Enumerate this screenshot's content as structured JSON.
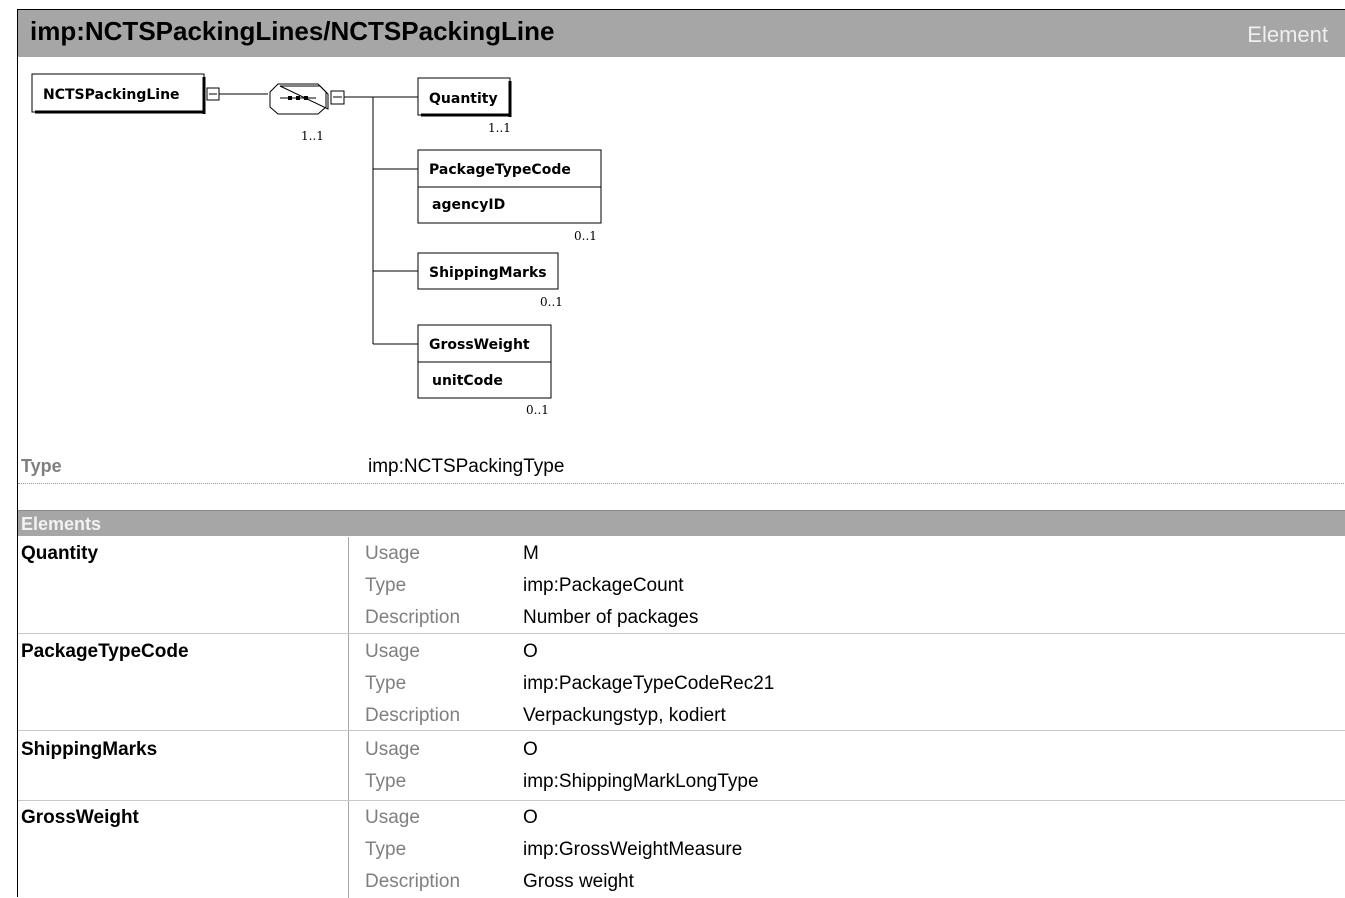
{
  "header": {
    "title": "imp:NCTSPackingLines/NCTSPackingLine",
    "kind": "Element"
  },
  "diagram": {
    "root": {
      "label": "NCTSPackingLine",
      "collapse_icon": "minus-box-icon"
    },
    "sequence": {
      "icon": "sequence-compositor-icon",
      "cardinality": "1..1",
      "collapse_icon": "minus-box-icon"
    },
    "children": [
      {
        "label": "Quantity",
        "attribute": "",
        "cardinality": "1..1"
      },
      {
        "label": "PackageTypeCode",
        "attribute": "agencyID",
        "cardinality": "0..1"
      },
      {
        "label": "ShippingMarks",
        "attribute": "",
        "cardinality": "0..1"
      },
      {
        "label": "GrossWeight",
        "attribute": "unitCode",
        "cardinality": "0..1"
      }
    ]
  },
  "type_row": {
    "label": "Type",
    "value": "imp:NCTSPackingType"
  },
  "elements_section": {
    "title": "Elements",
    "rows": [
      {
        "name": "Quantity",
        "fields": [
          {
            "key": "Usage",
            "value": "M"
          },
          {
            "key": "Type",
            "value": "imp:PackageCount"
          },
          {
            "key": "Description",
            "value": "Number of packages"
          }
        ]
      },
      {
        "name": "PackageTypeCode",
        "fields": [
          {
            "key": "Usage",
            "value": "O"
          },
          {
            "key": "Type",
            "value": "imp:PackageTypeCodeRec21"
          },
          {
            "key": "Description",
            "value": "Verpackungstyp, kodiert"
          }
        ]
      },
      {
        "name": "ShippingMarks",
        "fields": [
          {
            "key": "Usage",
            "value": "O"
          },
          {
            "key": "Type",
            "value": "imp:ShippingMarkLongType"
          }
        ]
      },
      {
        "name": "GrossWeight",
        "fields": [
          {
            "key": "Usage",
            "value": "O"
          },
          {
            "key": "Type",
            "value": "imp:GrossWeightMeasure"
          },
          {
            "key": "Description",
            "value": "Gross weight"
          }
        ]
      }
    ]
  }
}
